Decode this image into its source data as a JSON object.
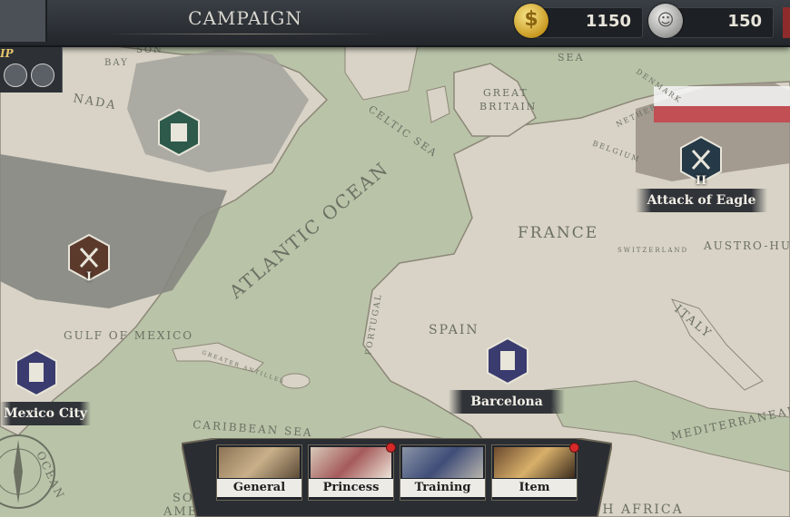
{
  "header": {
    "title": "CAMPAIGN",
    "gold": "1150",
    "silver": "150",
    "gold_icon": "dollar-coin-icon",
    "silver_icon": "medal-coin-icon"
  },
  "map_labels": {
    "atlantic": "ATLANTIC OCEAN",
    "celtic": "CELTIC SEA",
    "great_britain_1": "GREAT",
    "great_britain_2": "BRITAIN",
    "france": "FRANCE",
    "spain": "SPAIN",
    "portugal": "PORTUGAL",
    "italy": "ITALY",
    "austro": "AUSTRO-HUN",
    "switzerland": "SWITZERLAND",
    "belgium": "BELGIUM",
    "nether": "NETHER",
    "denmark": "DENMARK",
    "sea": "SEA",
    "gulf_mexico": "GULF OF MEXICO",
    "caribbean": "CARIBBEAN SEA",
    "mediterranean": "MEDITERRANEAN",
    "north_africa": "NORTH AFRICA",
    "america": "AMERICA",
    "south": "SO",
    "canada": "NADA",
    "bay": "BAY",
    "hudson": "SON",
    "ocean": "OCEAN",
    "greater_antilles": "GREATER ANTILLES"
  },
  "markers": {
    "attack_of_eagle": "Attack of Eagle",
    "attack_of_eagle_rank": "II",
    "barcelona": "Barcelona",
    "mexico_city": "Mexico City",
    "america_rank": "I"
  },
  "left_panel": {
    "label": "IP"
  },
  "menu": [
    {
      "label": "General",
      "dot": false
    },
    {
      "label": "Princess",
      "dot": true
    },
    {
      "label": "Training",
      "dot": false
    },
    {
      "label": "Item",
      "dot": true
    }
  ],
  "colors": {
    "sea": "#b9c3a8",
    "land": "#d8d3c6",
    "marker_dark": "#263947",
    "marker_green": "#2d5a4a",
    "marker_brown": "#5b3a2c",
    "marker_purple": "#3a3b6e"
  }
}
